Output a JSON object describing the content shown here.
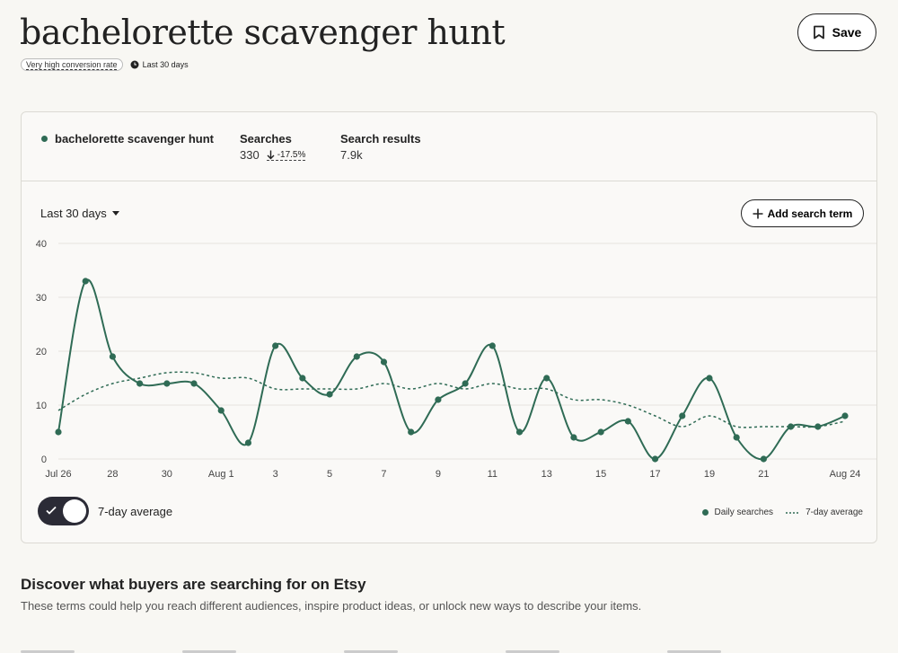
{
  "page": {
    "title": "bachelorette scavenger hunt",
    "save_label": "Save",
    "conversion_badge": "Very high conversion rate",
    "period": "Last 30 days"
  },
  "summary": {
    "term": "bachelorette scavenger hunt",
    "searches_label": "Searches",
    "searches_value": "330",
    "searches_delta": "-17.5%",
    "results_label": "Search results",
    "results_value": "7.9k"
  },
  "controls": {
    "range_label": "Last 30 days",
    "add_term_label": "Add search term",
    "toggle_label": "7-day average",
    "toggle_on": true
  },
  "legend": {
    "daily": "Daily searches",
    "avg": "7-day average"
  },
  "colors": {
    "series": "#2f6b55",
    "background": "#f8f7f3"
  },
  "chart_data": {
    "type": "line",
    "ylim": [
      0,
      40
    ],
    "yticks": [
      0,
      10,
      20,
      30,
      40
    ],
    "xticks": [
      {
        "index": 0,
        "label": "Jul 26"
      },
      {
        "index": 2,
        "label": "28"
      },
      {
        "index": 4,
        "label": "30"
      },
      {
        "index": 6,
        "label": "Aug 1"
      },
      {
        "index": 8,
        "label": "3"
      },
      {
        "index": 10,
        "label": "5"
      },
      {
        "index": 12,
        "label": "7"
      },
      {
        "index": 14,
        "label": "9"
      },
      {
        "index": 16,
        "label": "11"
      },
      {
        "index": 18,
        "label": "13"
      },
      {
        "index": 20,
        "label": "15"
      },
      {
        "index": 22,
        "label": "17"
      },
      {
        "index": 24,
        "label": "19"
      },
      {
        "index": 26,
        "label": "21"
      },
      {
        "index": 29,
        "label": "Aug 24"
      }
    ],
    "series": [
      {
        "name": "Daily searches",
        "style": "solid-markers",
        "values": [
          5,
          33,
          19,
          14,
          14,
          14,
          9,
          3,
          21,
          15,
          12,
          19,
          18,
          5,
          11,
          14,
          21,
          5,
          15,
          4,
          5,
          7,
          0,
          8,
          15,
          4,
          0,
          6,
          6,
          8
        ]
      },
      {
        "name": "7-day average",
        "style": "dotted",
        "values": [
          9,
          12,
          14,
          15,
          16,
          16,
          15,
          15,
          13,
          13,
          13,
          13,
          14,
          13,
          14,
          13,
          14,
          13,
          13,
          11,
          11,
          10,
          8,
          6,
          8,
          6,
          6,
          6,
          6,
          7
        ]
      }
    ],
    "grid": true
  },
  "discover": {
    "title": "Discover what buyers are searching for on Etsy",
    "subtitle": "These terms could help you reach different audiences, inspire product ideas, or unlock new ways to describe your items."
  }
}
